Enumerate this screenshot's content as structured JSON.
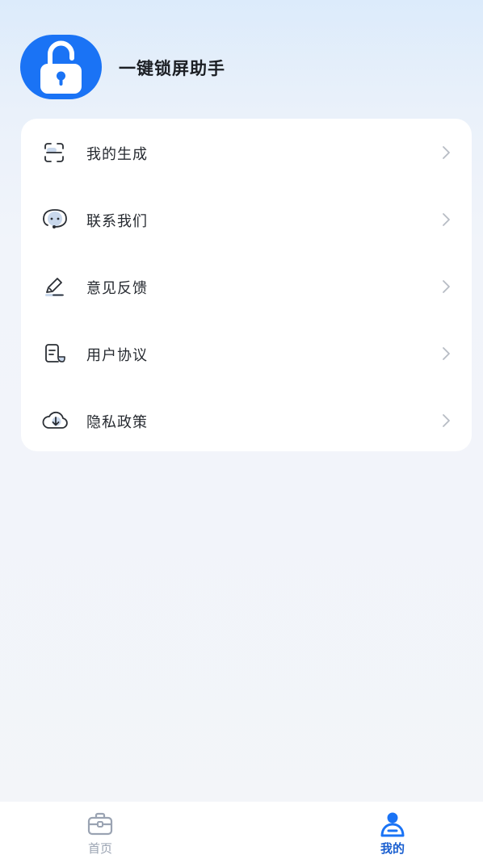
{
  "app": {
    "title": "一键锁屏助手"
  },
  "colors": {
    "accent": "#1a73f5",
    "inactive": "#9aa3b2",
    "chevron": "#b7bcc4"
  },
  "menu": {
    "items": [
      {
        "label": "我的生成",
        "icon": "scan-icon"
      },
      {
        "label": "联系我们",
        "icon": "customer-service-icon"
      },
      {
        "label": "意见反馈",
        "icon": "pencil-icon"
      },
      {
        "label": "用户协议",
        "icon": "document-icon"
      },
      {
        "label": "隐私政策",
        "icon": "cloud-download-icon"
      }
    ]
  },
  "tabbar": {
    "home_label": "首页",
    "mine_label": "我的",
    "active": "mine"
  }
}
